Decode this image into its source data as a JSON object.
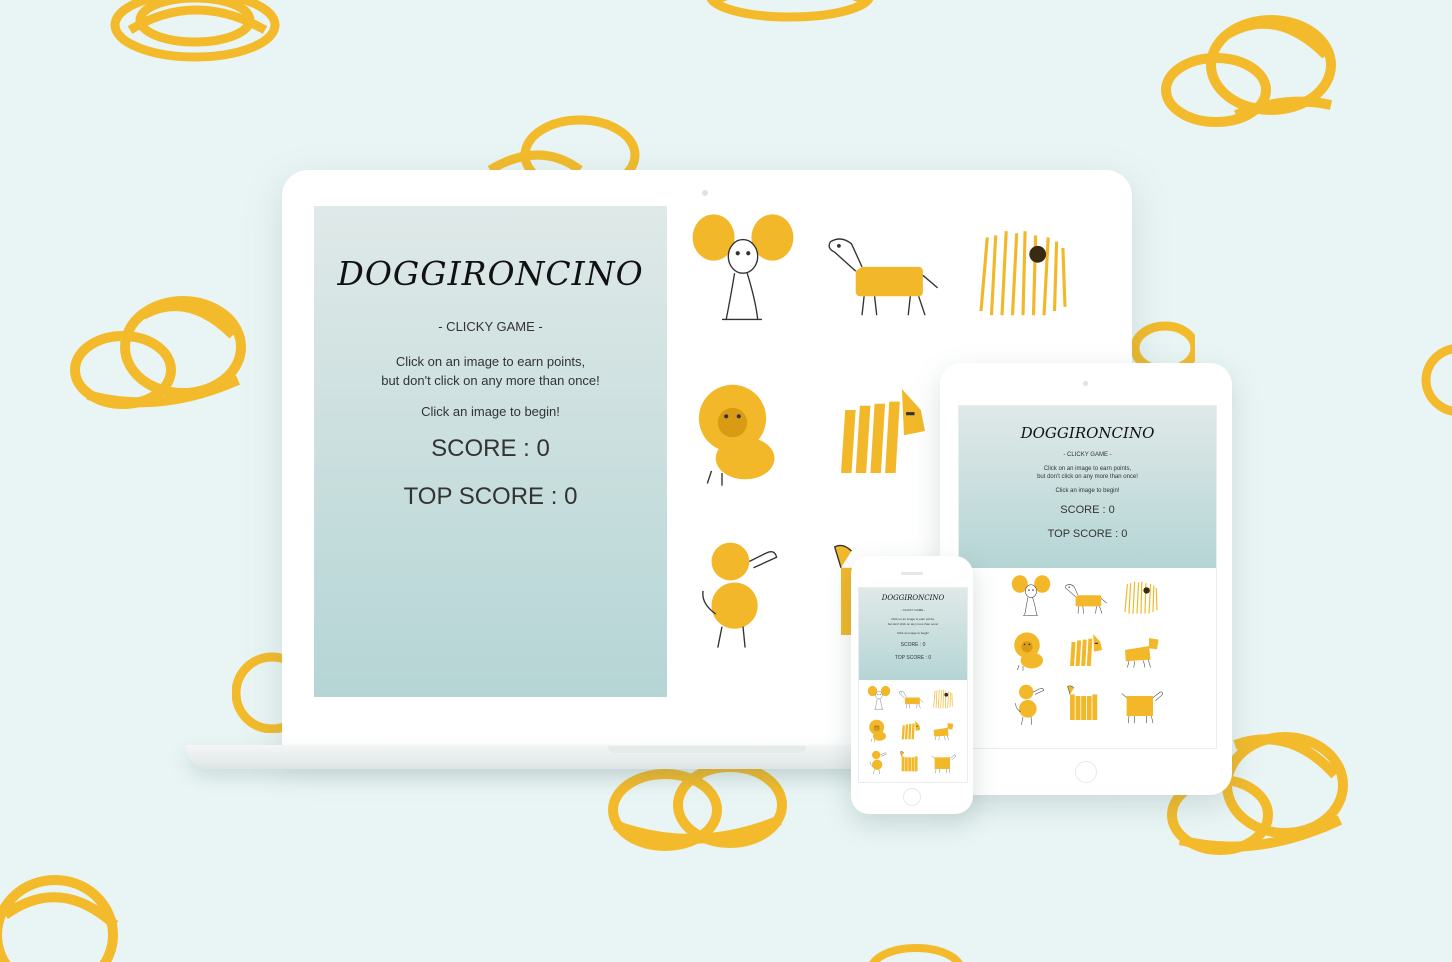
{
  "app": {
    "title": "DOGGIRONCINO",
    "subtitle": "- CLICKY GAME -",
    "instructions_line1": "Click on an image to earn points,",
    "instructions_line2": "but don't click on any more than once!",
    "status": "Click an image to begin!",
    "score_label": "SCORE : 0",
    "top_score_label": "TOP SCORE : 0"
  },
  "tiles": [
    {
      "name": "pasta-dog-chihuahua"
    },
    {
      "name": "pasta-dog-dachshund"
    },
    {
      "name": "pasta-dog-shaggy"
    },
    {
      "name": "pasta-dog-lion"
    },
    {
      "name": "pasta-dog-scottie"
    },
    {
      "name": "pasta-dog-terrier"
    },
    {
      "name": "pasta-dog-poodle"
    },
    {
      "name": "pasta-dog-afghan"
    },
    {
      "name": "pasta-dog-box"
    }
  ],
  "colors": {
    "background": "#e9f5f4",
    "panel_top": "#dfe9e8",
    "panel_bottom": "#b5d5d5",
    "pasta": "#f2b82a"
  }
}
